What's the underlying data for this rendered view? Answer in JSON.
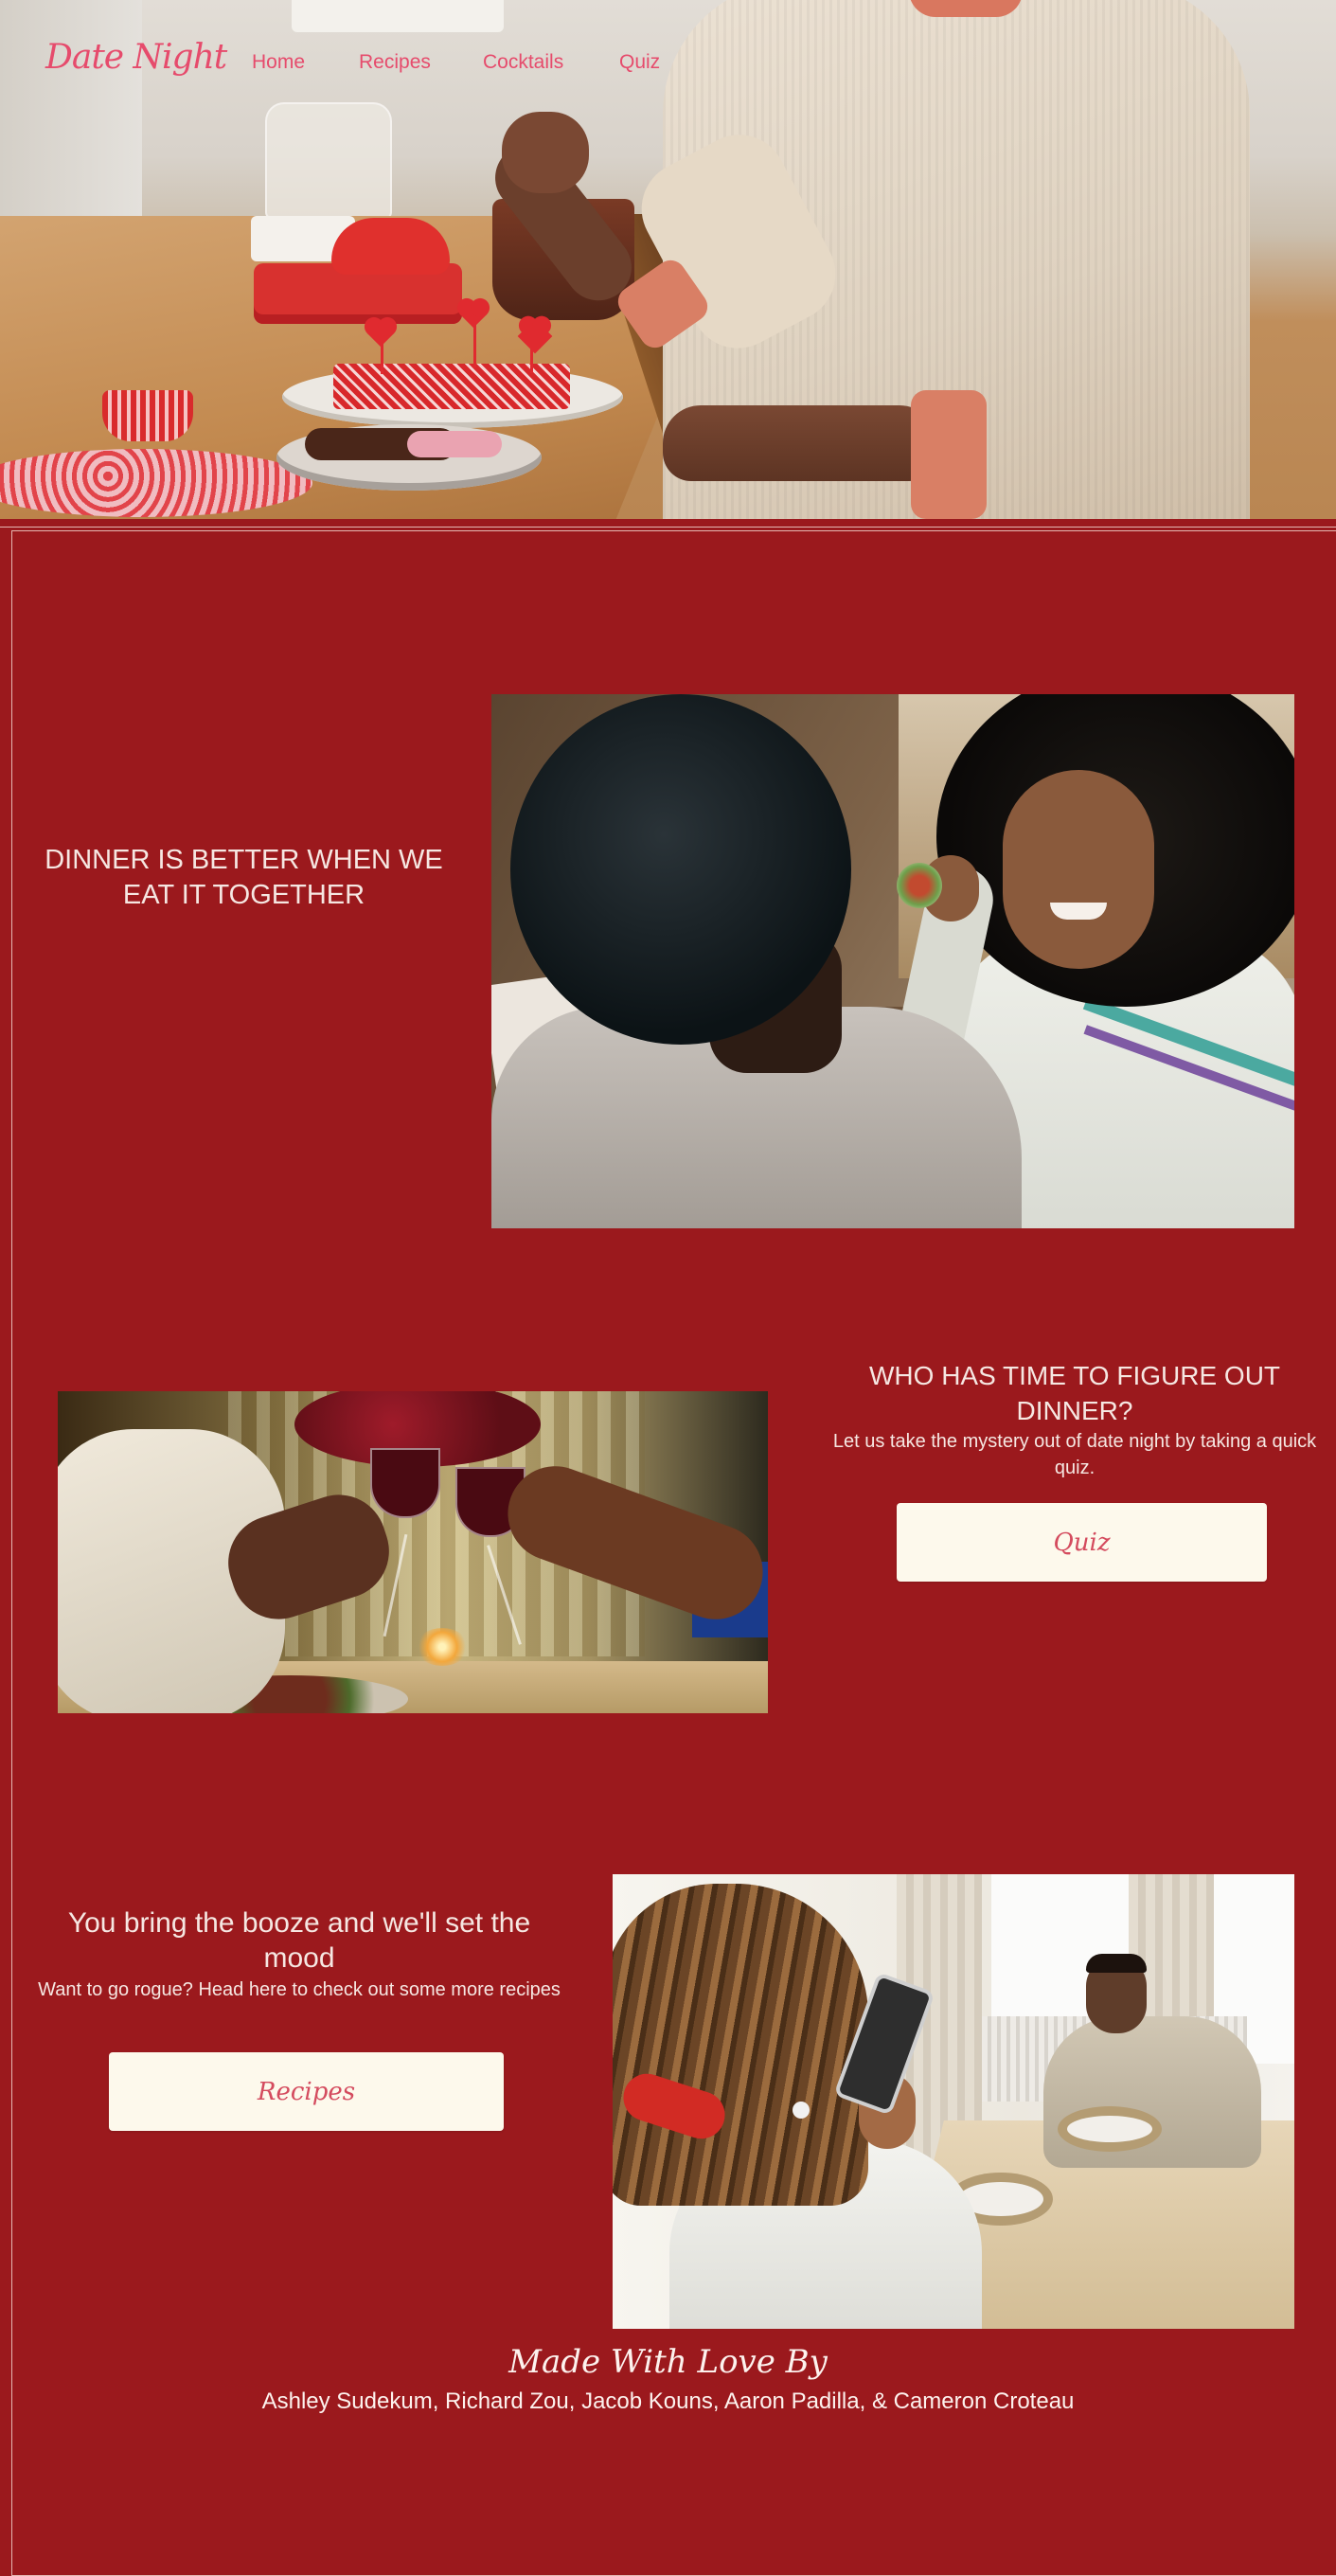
{
  "header": {
    "logo": "Date Night",
    "nav": [
      {
        "label": "Home"
      },
      {
        "label": "Recipes"
      },
      {
        "label": "Cocktails"
      },
      {
        "label": "Quiz"
      }
    ]
  },
  "section1": {
    "heading": "DINNER IS BETTER WHEN WE EAT IT TOGETHER"
  },
  "section2": {
    "heading": "WHO HAS TIME TO FIGURE OUT DINNER?",
    "text": "Let us take the mystery out of date night by taking a quick quiz.",
    "button": "Quiz"
  },
  "section3": {
    "heading": "You bring the booze and we'll set the mood",
    "text": "Want to go rogue? Head here to check out some more recipes",
    "button": "Recipes"
  },
  "footer": {
    "title": "Made With Love By",
    "names": "Ashley Sudekum, Richard Zou, Jacob Kouns, Aaron Padilla, & Cameron Croteau"
  },
  "colors": {
    "background": "#9b191d",
    "accent": "#e64b6c",
    "button_bg": "#fdf9ec",
    "text_light": "#f6e7e2"
  }
}
